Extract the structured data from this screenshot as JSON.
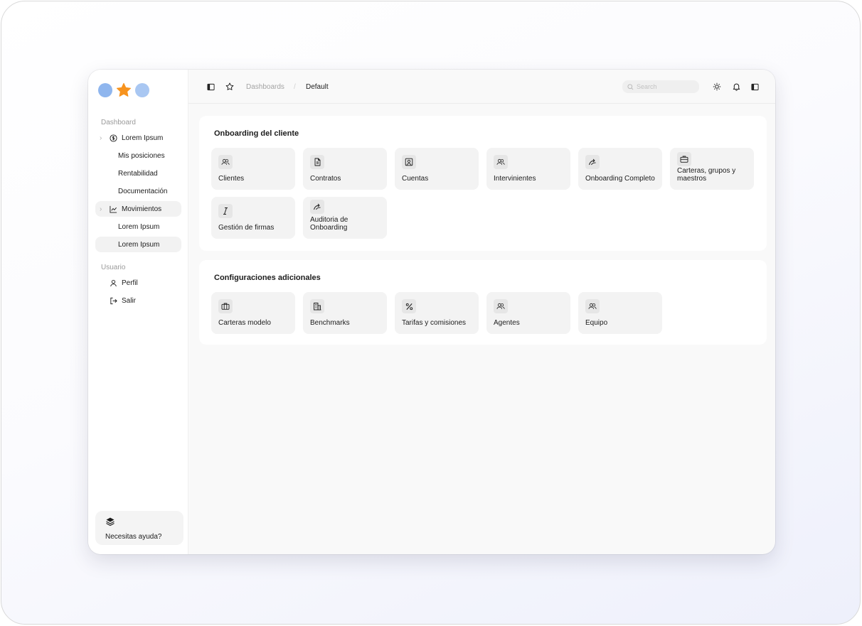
{
  "breadcrumb": {
    "parent": "Dashboards",
    "separator": "/",
    "current": "Default"
  },
  "search": {
    "placeholder": "Search"
  },
  "sidebar": {
    "section_dashboard": "Dashboard",
    "items": [
      {
        "label": "Lorem Ipsum",
        "icon": "dollar-circle-icon"
      },
      {
        "label": "Mis posiciones"
      },
      {
        "label": "Rentabilidad"
      },
      {
        "label": "Documentación"
      },
      {
        "label": "Movimientos",
        "icon": "chart-line-icon"
      },
      {
        "label": "Lorem Ipsum"
      },
      {
        "label": "Lorem Ipsum"
      }
    ],
    "section_user": "Usuario",
    "user_items": [
      {
        "label": "Perfil",
        "icon": "user-icon"
      },
      {
        "label": "Salir",
        "icon": "logout-icon"
      }
    ],
    "help": {
      "label": "Necesitas ayuda?",
      "icon": "layers-icon"
    }
  },
  "onboarding": {
    "title": "Onboarding del cliente",
    "tiles": [
      {
        "label": "Clientes",
        "icon": "users-icon"
      },
      {
        "label": "Contratos",
        "icon": "document-icon"
      },
      {
        "label": "Cuentas",
        "icon": "account-icon"
      },
      {
        "label": "Intervinientes",
        "icon": "users-icon"
      },
      {
        "label": "Onboarding Completo",
        "icon": "arrows-icon"
      },
      {
        "label": "Carteras, grupos y maestros",
        "icon": "briefcase-icon"
      },
      {
        "label": "Gestión de firmas",
        "icon": "italic-icon"
      },
      {
        "label": "Auditoria de Onboarding",
        "icon": "arrows-icon"
      }
    ]
  },
  "config": {
    "title": "Configuraciones adicionales",
    "tiles": [
      {
        "label": "Carteras modelo",
        "icon": "briefcase-icon"
      },
      {
        "label": "Benchmarks",
        "icon": "building-icon"
      },
      {
        "label": "Tarifas y comisiones",
        "icon": "percent-icon"
      },
      {
        "label": "Agentes",
        "icon": "users-icon"
      },
      {
        "label": "Equipo",
        "icon": "users-icon"
      }
    ]
  },
  "colors": {
    "brand_blue": "#8fb6ee",
    "brand_orange": "#f7931e",
    "tile_bg": "#f3f3f3"
  }
}
